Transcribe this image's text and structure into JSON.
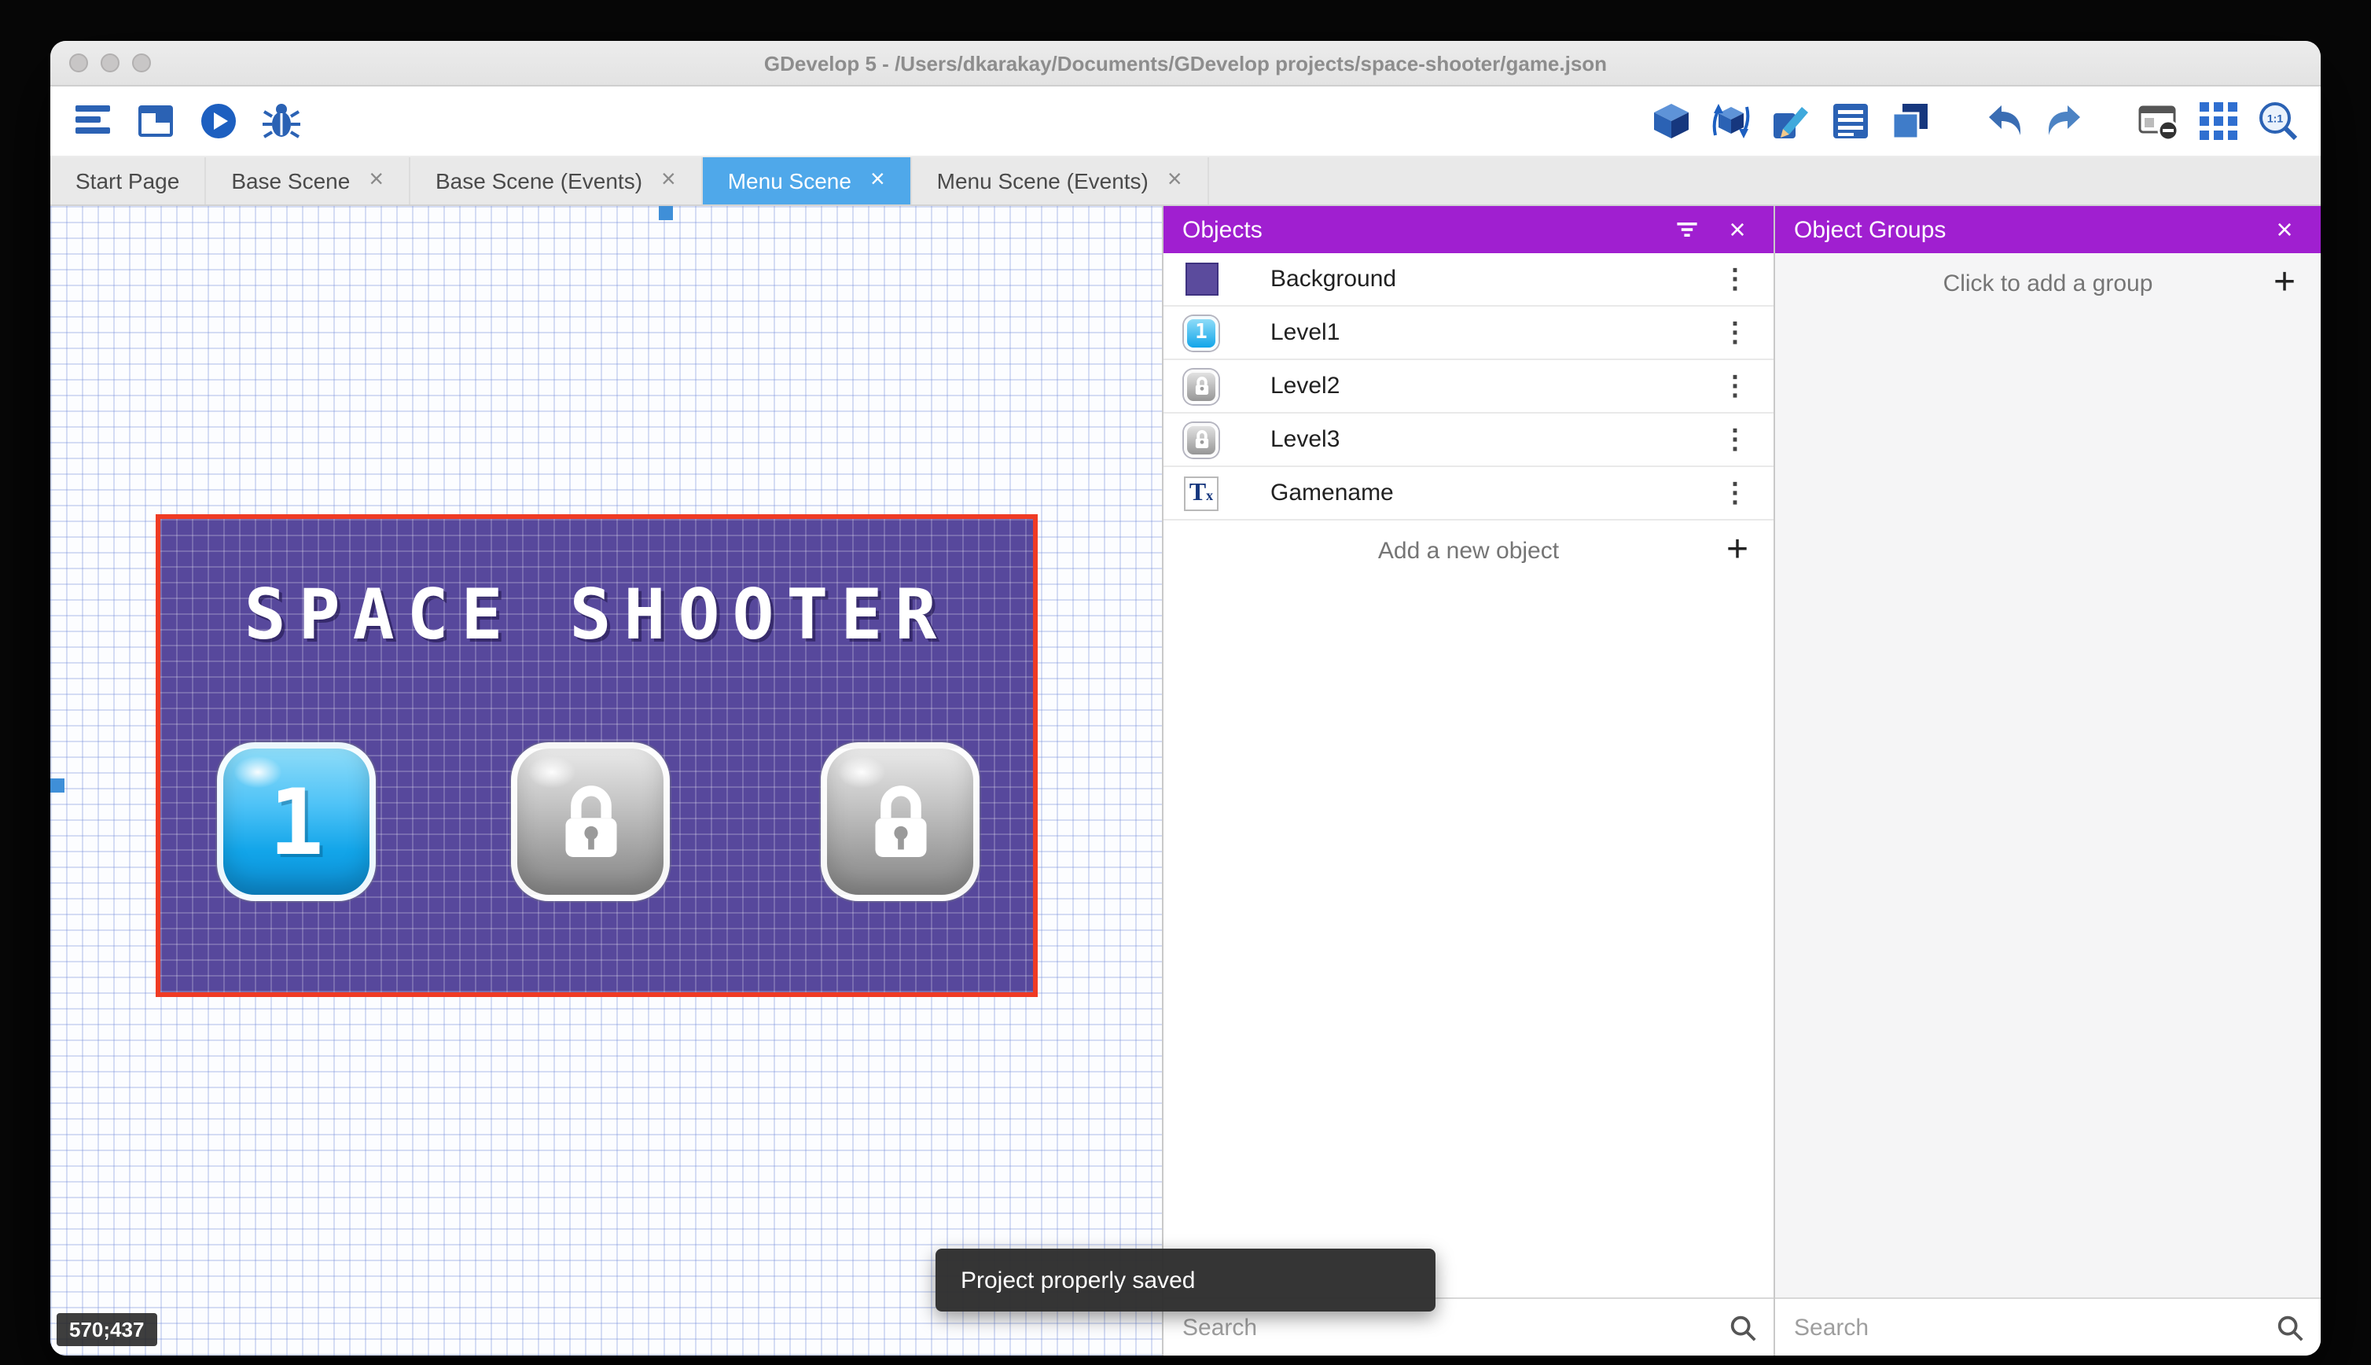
{
  "window": {
    "title": "GDevelop 5 - /Users/dkarakay/Documents/GDevelop projects/space-shooter/game.json"
  },
  "tabs": [
    {
      "label": "Start Page"
    },
    {
      "label": "Base Scene"
    },
    {
      "label": "Base Scene (Events)"
    },
    {
      "label": "Menu Scene"
    },
    {
      "label": "Menu Scene (Events)"
    }
  ],
  "canvas": {
    "coordinates": "570;437",
    "scene": {
      "title": "SPACE SHOOTER",
      "level1_label": "1"
    }
  },
  "objects_panel": {
    "title": "Objects",
    "items": [
      {
        "name": "Background",
        "icon": "background-swatch"
      },
      {
        "name": "Level1",
        "icon": "level1-button",
        "badge": "1"
      },
      {
        "name": "Level2",
        "icon": "locked-button"
      },
      {
        "name": "Level3",
        "icon": "locked-button"
      },
      {
        "name": "Gamename",
        "icon": "text-object"
      }
    ],
    "add_label": "Add a new object",
    "search_placeholder": "Search"
  },
  "groups_panel": {
    "title": "Object Groups",
    "add_label": "Click to add a group",
    "search_placeholder": "Search"
  },
  "snackbar": {
    "message": "Project properly saved"
  },
  "glyphs": {
    "dots": "⋮",
    "close": "×",
    "plus": "+",
    "text_t": "T",
    "text_x": "x"
  },
  "colors": {
    "accent_purple": "#A01FD0",
    "active_tab_blue": "#4FA8EA",
    "selection_red": "#EF3B24",
    "scene_purple": "#57489C",
    "toolbar_blue": "#2B62B4"
  }
}
